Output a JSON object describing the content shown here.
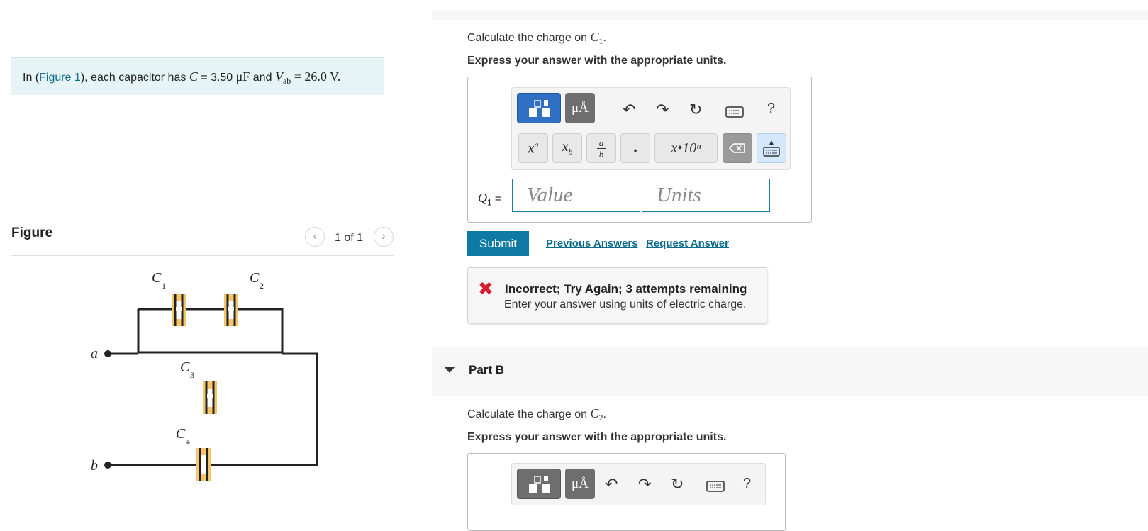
{
  "problem": {
    "prefix": "In (",
    "link": "Figure 1",
    "mid": "), each capacitor has",
    "c_math": "C",
    "eq": " = 3.50",
    "c_unit": "μF",
    "and": "and",
    "v_math": "V",
    "v_sub": "ab",
    "v_val": "= 26.0 V."
  },
  "figure": {
    "title": "Figure",
    "pager": "1 of 1",
    "prev_icon": "chevron-left-icon",
    "next_icon": "chevron-right-icon",
    "labels": {
      "c1": "C",
      "c1s": "1",
      "c2": "C",
      "c2s": "2",
      "c3": "C",
      "c3s": "3",
      "c4": "C",
      "c4s": "4",
      "a": "a",
      "b": "b"
    },
    "colors": {
      "wire": "#222222",
      "cap_fill": "#f6c56b",
      "plate": "#222222"
    }
  },
  "partA": {
    "prompt_pre": "Calculate the charge on",
    "prompt_math": "C",
    "prompt_sub": "1",
    "prompt_post": ".",
    "instruction": "Express your answer with the appropriate units.",
    "toolbar": {
      "units_label": "μÅ",
      "help": "?",
      "keys": {
        "superscript": "xa",
        "subscript": "xb",
        "fraction_top": "a",
        "fraction_bot": "b",
        "dot": "•",
        "sci": "x•10ⁿ"
      }
    },
    "eq_label": "Q",
    "eq_sub": "1",
    "eq_sign": " =",
    "value_placeholder": "Value",
    "units_placeholder": "Units",
    "submit": "Submit",
    "previous_answers": "Previous Answers",
    "request_answer": "Request Answer",
    "feedback": {
      "title": "Incorrect; Try Again; 3 attempts remaining",
      "message": "Enter your answer using units of electric charge.",
      "color": "#d41f2e"
    }
  },
  "partB": {
    "label": "Part B",
    "prompt_pre": "Calculate the charge on",
    "prompt_math": "C",
    "prompt_sub": "2",
    "prompt_post": ".",
    "instruction": "Express your answer with the appropriate units.",
    "toolbar": {
      "units_label": "μÅ",
      "help": "?"
    }
  },
  "colors": {
    "accent": "#0f7aa5",
    "template_active": "#2f6fc4",
    "problem_bg": "#e6f4f5"
  }
}
